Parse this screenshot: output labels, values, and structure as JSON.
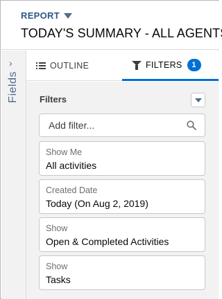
{
  "header": {
    "report_label": "REPORT",
    "title": "TODAY'S SUMMARY - ALL AGENTS"
  },
  "rail": {
    "label": "Fields",
    "expand_icon": "chevron-right-icon"
  },
  "tabs": [
    {
      "label": "OUTLINE",
      "icon": "list-icon",
      "active": false
    },
    {
      "label": "FILTERS",
      "icon": "filter-icon",
      "active": true,
      "badge": "1"
    }
  ],
  "filters_panel": {
    "heading": "Filters",
    "search": {
      "placeholder": "Add filter..."
    },
    "items": [
      {
        "label": "Show Me",
        "value": "All activities"
      },
      {
        "label": "Created Date",
        "value": "Today (On Aug 2, 2019)"
      },
      {
        "label": "Show",
        "value": "Open & Completed Activities"
      },
      {
        "label": "Show",
        "value": "Tasks"
      }
    ]
  },
  "colors": {
    "accent": "#0070d2",
    "report_label": "#2e5787",
    "panel_bg": "#f3f2f2"
  }
}
